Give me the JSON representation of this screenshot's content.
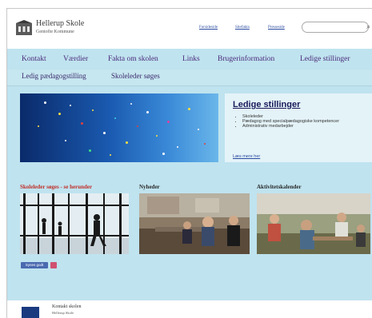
{
  "header": {
    "school_name": "Hellerup Skole",
    "school_sub": "Gentofte Kommune",
    "links": [
      "Forsideside",
      "Sitefakta",
      "Presseside"
    ]
  },
  "nav": {
    "items": [
      "Kontakt",
      "Værdier",
      "Fakta om skolen",
      "Links",
      "Brugerinformation",
      "Ledige stillinger"
    ]
  },
  "subnav": {
    "items": [
      "Ledig pædagogstilling",
      "Skoleleder søges"
    ]
  },
  "jobs": {
    "title": "Ledige stillinger",
    "items": [
      "Skoleleder",
      "Pædagog med specialpædagogiske kompetencer",
      "Administrativ medarbejder"
    ],
    "more": "Læs mere her"
  },
  "columns": [
    {
      "title": "Skoleleder søges - se herunder",
      "color": "#c0302a"
    },
    {
      "title": "Nyheder",
      "color": "#1a1a1a"
    },
    {
      "title": "Aktivitetskalender",
      "color": "#1a1a1a"
    }
  ],
  "social": {
    "fb_label": "Synes godt"
  },
  "footer": {
    "title": "Kontakt skolen",
    "sub": "Hellerup Skole"
  },
  "colors": {
    "background": "#bfe3ef",
    "nav_text": "#4a2a7a",
    "banner": "#1a5ab0",
    "accent_red": "#c0302a"
  }
}
